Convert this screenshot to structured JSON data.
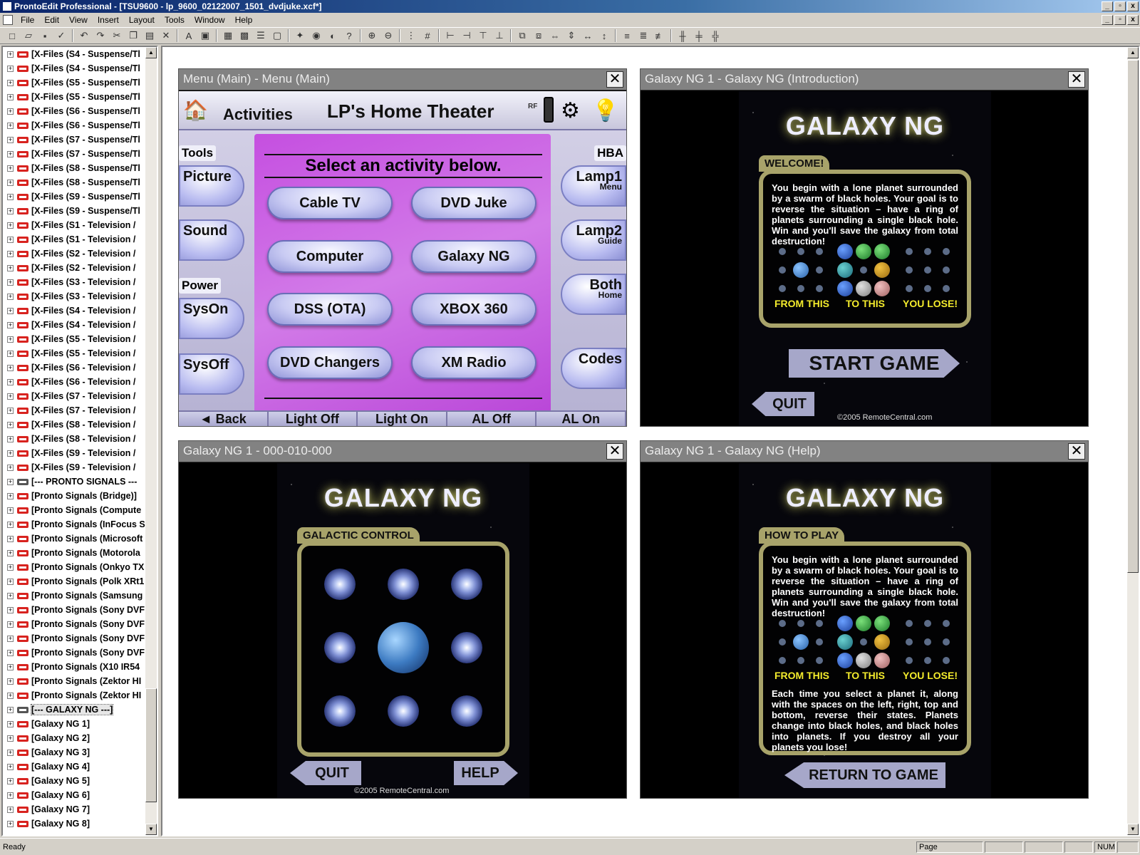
{
  "window": {
    "title": "ProntoEdit Professional - [TSU9600 - lp_9600_02122007_1501_dvdjuke.xcf*]"
  },
  "menu": [
    "File",
    "Edit",
    "View",
    "Insert",
    "Layout",
    "Tools",
    "Window",
    "Help"
  ],
  "tree": [
    "[X-Files (S4 - Suspense/Tl",
    "[X-Files (S4 - Suspense/Tl",
    "[X-Files (S5 - Suspense/Tl",
    "[X-Files (S5 - Suspense/Tl",
    "[X-Files (S6 - Suspense/Tl",
    "[X-Files (S6 - Suspense/Tl",
    "[X-Files (S7 - Suspense/Tl",
    "[X-Files (S7 - Suspense/Tl",
    "[X-Files (S8 - Suspense/Tl",
    "[X-Files (S8 - Suspense/Tl",
    "[X-Files (S9 - Suspense/Tl",
    "[X-Files (S9 - Suspense/Tl",
    "[X-Files (S1 - Television /",
    "[X-Files (S1 - Television /",
    "[X-Files (S2 - Television /",
    "[X-Files (S2 - Television /",
    "[X-Files (S3 - Television /",
    "[X-Files (S3 - Television /",
    "[X-Files (S4 - Television /",
    "[X-Files (S4 - Television /",
    "[X-Files (S5 - Television /",
    "[X-Files (S5 - Television /",
    "[X-Files (S6 - Television /",
    "[X-Files (S6 - Television /",
    "[X-Files (S7 - Television /",
    "[X-Files (S7 - Television /",
    "[X-Files (S8 - Television /",
    "[X-Files (S8 - Television /",
    "[X-Files (S9 - Television /",
    "[X-Files (S9 - Television /",
    "[--- PRONTO SIGNALS ---",
    "[Pronto Signals (Bridge)]",
    "[Pronto Signals (Compute",
    "[Pronto Signals (InFocus S",
    "[Pronto Signals (Microsoft",
    "[Pronto Signals (Motorola",
    "[Pronto Signals (Onkyo TX",
    "[Pronto Signals (Polk XRt1",
    "[Pronto Signals (Samsung",
    "[Pronto Signals (Sony DVF",
    "[Pronto Signals (Sony DVF",
    "[Pronto Signals (Sony DVF",
    "[Pronto Signals (Sony DVF",
    "[Pronto Signals (X10 IR54",
    "[Pronto Signals (Zektor HI",
    "[Pronto Signals (Zektor HI",
    "[--- GALAXY NG ---]",
    "[Galaxy NG 1]",
    "[Galaxy NG 2]",
    "[Galaxy NG 3]",
    "[Galaxy NG 4]",
    "[Galaxy NG 5]",
    "[Galaxy NG 6]",
    "[Galaxy NG 7]",
    "[Galaxy NG 8]"
  ],
  "panels": {
    "menu_main": {
      "title": "Menu (Main) - Menu (Main)",
      "activities": "Activities",
      "heading": "LP's Home Theater",
      "rf": "RF",
      "prompt": "Select an activity below.",
      "buttons": [
        "Cable TV",
        "DVD Juke",
        "Computer",
        "Galaxy NG",
        "DSS (OTA)",
        "XBOX 360",
        "DVD Changers",
        "XM Radio"
      ],
      "left_tools": "Tools",
      "left_power": "Power",
      "picture": "Picture",
      "sound": "Sound",
      "syson": "SysOn",
      "sysoff": "SysOff",
      "hba": "HBA",
      "lamp1": "Lamp1",
      "lamp1_sub": "Menu",
      "lamp2": "Lamp2",
      "lamp2_sub": "Guide",
      "both": "Both",
      "both_sub": "Home",
      "codes": "Codes",
      "footer": [
        "◄ Back",
        "Light Off",
        "Light On",
        "AL Off",
        "AL On"
      ]
    },
    "intro": {
      "title": "Galaxy NG 1 - Galaxy NG (Introduction)",
      "logo": "GALAXY NG",
      "tab": "WELCOME!",
      "text": "You begin with a lone planet surrounded by a swarm of black holes. Your goal is to reverse the situation – have a ring of planets surrounding a single black hole. Win and you'll save the galaxy from total destruction!",
      "from": "FROM THIS",
      "to": "TO THIS",
      "lose": "YOU LOSE!",
      "start": "START GAME",
      "quit": "QUIT",
      "copyright": "©2005 RemoteCentral.com"
    },
    "control": {
      "title": "Galaxy NG 1 - 000-010-000",
      "logo": "GALAXY NG",
      "tab": "GALACTIC CONTROL",
      "quit": "QUIT",
      "help": "HELP",
      "copyright": "©2005 RemoteCentral.com"
    },
    "help": {
      "title": "Galaxy NG 1 - Galaxy NG (Help)",
      "logo": "GALAXY NG",
      "tab": "HOW TO PLAY",
      "text": "You begin with a lone planet surrounded by a swarm of black holes. Your goal is to reverse the situation – have a ring of planets surrounding a single black hole. Win and you'll save the galaxy from total destruction!",
      "from": "FROM THIS",
      "to": "TO THIS",
      "lose": "YOU LOSE!",
      "text2": "Each time you select a planet it, along with the spaces on the left, right, top and bottom, reverse their states. Planets change into black holes, and black holes into planets. If you destroy all your planets you lose!",
      "return": "RETURN TO GAME"
    }
  },
  "status": {
    "ready": "Ready",
    "page": "Page",
    "num": "NUM"
  }
}
